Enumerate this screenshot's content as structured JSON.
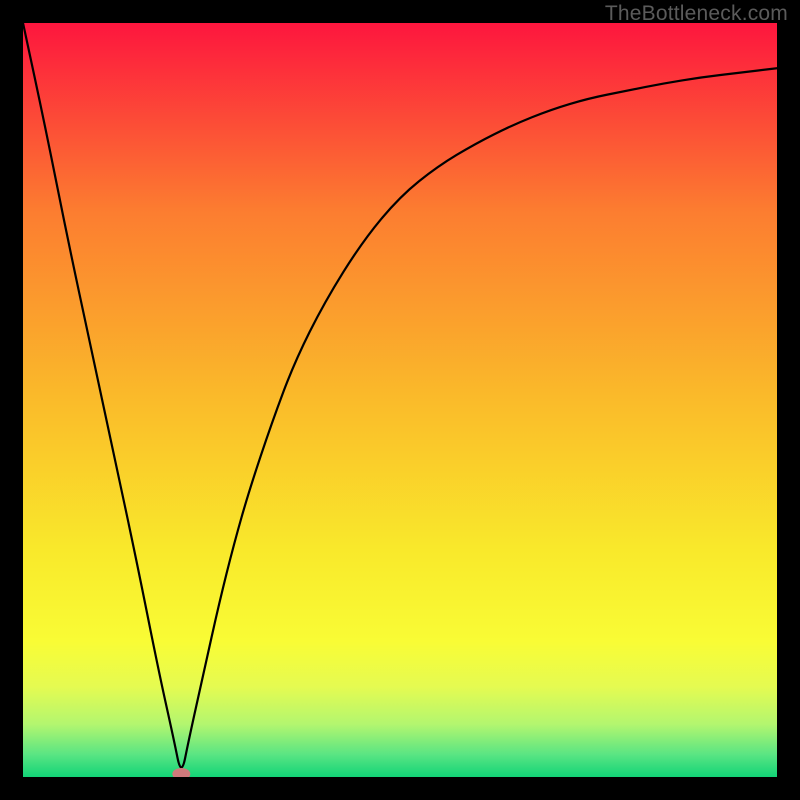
{
  "watermark": "TheBottleneck.com",
  "chart_data": {
    "type": "line",
    "title": "",
    "xlabel": "",
    "ylabel": "",
    "xlim": [
      0,
      100
    ],
    "ylim": [
      0,
      100
    ],
    "grid": false,
    "legend": false,
    "background_gradient": {
      "type": "vertical",
      "stops": [
        {
          "pos": 0.0,
          "color": "#fd163e"
        },
        {
          "pos": 0.25,
          "color": "#fc7d30"
        },
        {
          "pos": 0.5,
          "color": "#fabb2a"
        },
        {
          "pos": 0.7,
          "color": "#f9e92b"
        },
        {
          "pos": 0.82,
          "color": "#f9fc35"
        },
        {
          "pos": 0.88,
          "color": "#e5fb51"
        },
        {
          "pos": 0.93,
          "color": "#b3f66f"
        },
        {
          "pos": 0.97,
          "color": "#5ae583"
        },
        {
          "pos": 1.0,
          "color": "#12d477"
        }
      ]
    },
    "marker": {
      "x": 21,
      "y": 0,
      "color": "#cf7a7c"
    },
    "series": [
      {
        "name": "curve",
        "color": "#000000",
        "x": [
          0,
          3,
          6,
          9,
          12,
          15,
          18,
          20,
          21,
          22,
          24,
          26,
          28,
          30,
          33,
          36,
          40,
          45,
          50,
          55,
          60,
          65,
          70,
          75,
          80,
          85,
          90,
          95,
          100
        ],
        "y": [
          100,
          86,
          71,
          57,
          43,
          29,
          14,
          5,
          0,
          5,
          14,
          23,
          31,
          38,
          47,
          55,
          63,
          71,
          77,
          81,
          84,
          86.5,
          88.5,
          90,
          91,
          92,
          92.8,
          93.4,
          94
        ]
      }
    ]
  }
}
